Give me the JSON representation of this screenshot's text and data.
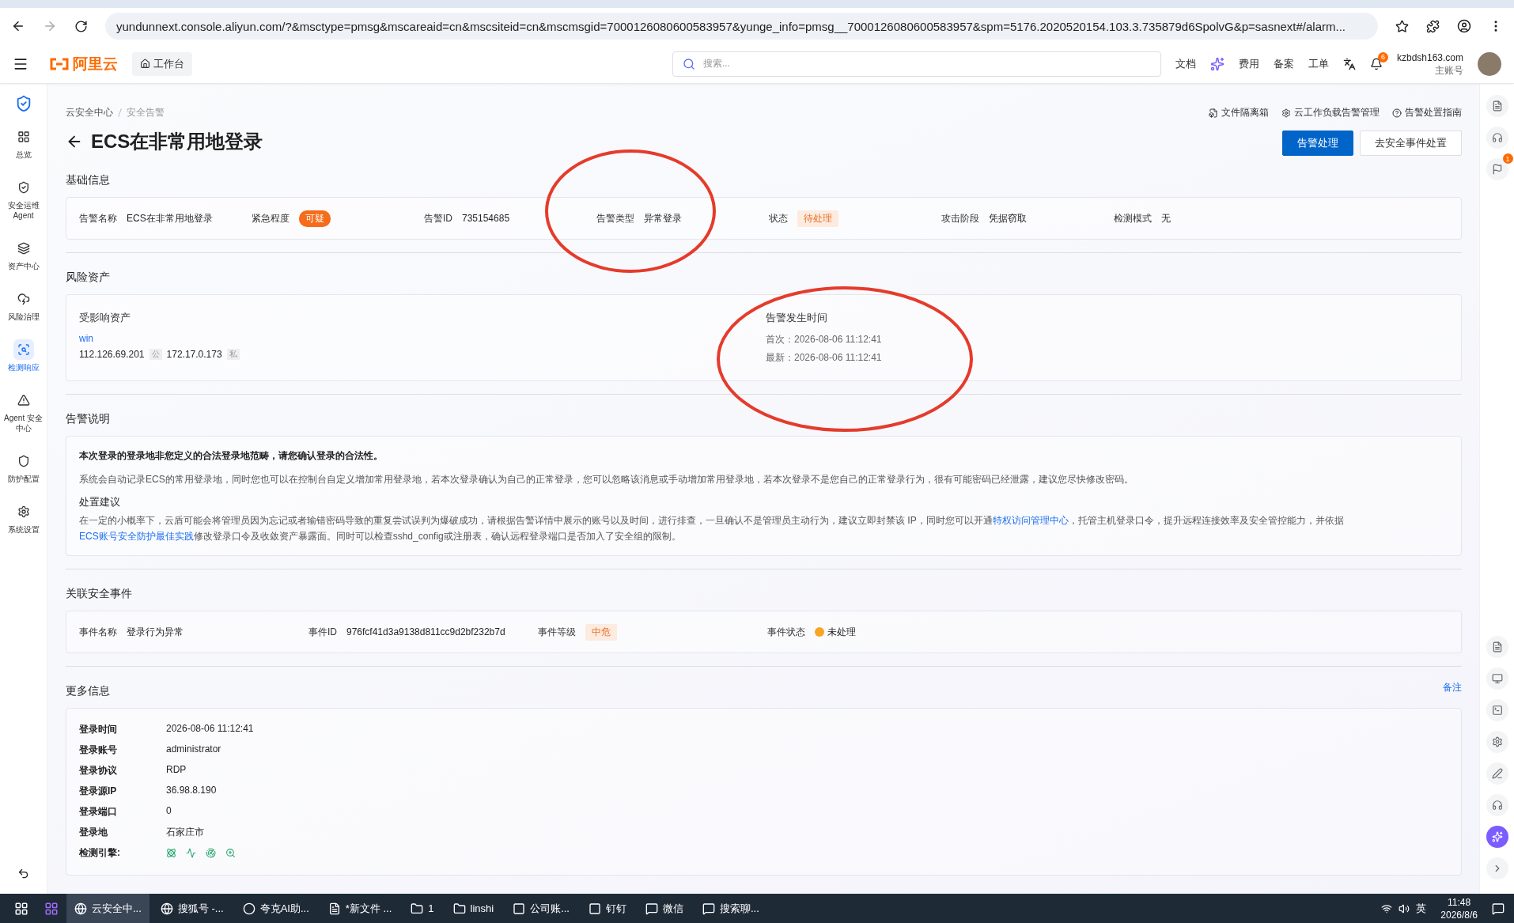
{
  "browser": {
    "url": "yundunnext.console.aliyun.com/?&msctype=pmsg&mscareaid=cn&mscsiteid=cn&mscmsgid=7000126080600583957&yunge_info=pmsg__7000126080600583957&spm=5176.2020520154.103.3.735879d6SpolvG&p=sasnext#/alarm..."
  },
  "header": {
    "logo_text": "阿里云",
    "workbench": "工作台",
    "search_placeholder": "搜索...",
    "nav": [
      "文档",
      "费用",
      "备案",
      "工单"
    ],
    "notification_count": "6",
    "account": "kzbdsh163.com",
    "role": "主账号"
  },
  "sidebar": {
    "items": [
      {
        "label": "总览",
        "selected": false
      },
      {
        "label": "安全运维 Agent",
        "selected": false
      },
      {
        "label": "资产中心",
        "selected": false
      },
      {
        "label": "风险治理",
        "selected": false
      },
      {
        "label": "检测响应",
        "selected": true
      },
      {
        "label": "Agent 安全中心",
        "selected": false
      },
      {
        "label": "防护配置",
        "selected": false
      },
      {
        "label": "系统设置",
        "selected": false
      }
    ]
  },
  "breadcrumb": [
    "云安全中心",
    "安全告警"
  ],
  "title": "ECS在非常用地登录",
  "top_links": [
    "文件隔离箱",
    "云工作负载告警管理",
    "告警处置指南"
  ],
  "buttons": [
    {
      "label": "告警处理",
      "kind": "primary"
    },
    {
      "label": "去安全事件处置",
      "kind": "default"
    }
  ],
  "basic_info": {
    "title": "基础信息",
    "fields": [
      {
        "label": "告警名称",
        "value": "ECS在非常用地登录",
        "kind": "text"
      },
      {
        "label": "紧急程度",
        "value": "可疑",
        "kind": "badge"
      },
      {
        "label": "告警ID",
        "value": "735154685",
        "kind": "text"
      },
      {
        "label": "告警类型",
        "value": "异常登录",
        "kind": "text"
      },
      {
        "label": "状态",
        "value": "待处理",
        "kind": "tag"
      },
      {
        "label": "攻击阶段",
        "value": "凭据窃取",
        "kind": "text"
      },
      {
        "label": "检测模式",
        "value": "无",
        "kind": "text"
      }
    ]
  },
  "risk_assets": {
    "title": "风险资产",
    "affected_title": "受影响资产",
    "asset_name": "win",
    "ips": [
      {
        "ip": "112.126.69.201",
        "tag": "公"
      },
      {
        "ip": "172.17.0.173",
        "tag": "私"
      }
    ],
    "time_title": "告警发生时间",
    "times": [
      "首次：2026-08-06 11:12:41",
      "最新：2026-08-06 11:12:41"
    ]
  },
  "description": {
    "title": "告警说明",
    "headline": "本次登录的登录地非您定义的合法登录地范畴，请您确认登录的合法性。",
    "body": "系统会自动记录ECS的常用登录地，同时您也可以在控制台自定义增加常用登录地，若本次登录确认为自己的正常登录，您可以忽略该消息或手动增加常用登录地，若本次登录不是您自己的正常登录行为，很有可能密码已经泄露，建议您尽快修改密码。",
    "advice_title": "处置建议",
    "advice": [
      {
        "text": "在一定的小概率下，云盾可能会将管理员因为忘记或者输错密码导致的重复尝试误判为爆破成功，请根据告警详情中展示的账号以及时间，进行排查，一旦确认不是管理员主动行为，建议立即封禁该 IP，同时您可以开通",
        "link": false
      },
      {
        "text": "特权访问管理中心",
        "link": true
      },
      {
        "text": "，托管主机登录口令，提升远程连接效率及安全管控能力，并依据",
        "link": false
      },
      {
        "text": "ECS账号安全防护最佳实践",
        "link": true
      },
      {
        "text": "修改登录口令及收敛资产暴露面。同时可以检查sshd_config或注册表，确认远程登录端口是否加入了安全组的限制。",
        "link": false
      }
    ]
  },
  "related_event": {
    "title": "关联安全事件",
    "fields": [
      {
        "label": "事件名称",
        "value": "登录行为异常",
        "kind": "text"
      },
      {
        "label": "事件ID",
        "value": "976fcf41d3a9138d811cc9d2bf232b7d",
        "kind": "text"
      },
      {
        "label": "事件等级",
        "value": "中危",
        "kind": "tag"
      },
      {
        "label": "事件状态",
        "value": "未处理",
        "kind": "status"
      }
    ]
  },
  "more_info": {
    "title": "更多信息",
    "note_link": "备注",
    "rows": [
      {
        "label": "登录时间",
        "value": "2026-08-06 11:12:41"
      },
      {
        "label": "登录账号",
        "value": "administrator"
      },
      {
        "label": "登录协议",
        "value": "RDP"
      },
      {
        "label": "登录源IP",
        "value": "36.98.8.190"
      },
      {
        "label": "登录端口",
        "value": "0"
      },
      {
        "label": "登录地",
        "value": "石家庄市"
      }
    ],
    "engines_label": "检测引擎:"
  },
  "right_rail": {
    "flag_badge": "1"
  },
  "taskbar": {
    "apps": [
      {
        "label": "云安全中...",
        "selected": true
      },
      {
        "label": "搜狐号 -...",
        "selected": false
      },
      {
        "label": "夸克AI助...",
        "selected": false
      },
      {
        "label": "*新文件 ...",
        "selected": false
      },
      {
        "label": "1",
        "selected": false
      },
      {
        "label": "linshi",
        "selected": false
      },
      {
        "label": "公司账...",
        "selected": false
      },
      {
        "label": "钉钉",
        "selected": false
      },
      {
        "label": "微信",
        "selected": false
      },
      {
        "label": "搜索聊...",
        "selected": false
      }
    ],
    "ime": "英",
    "time": "11:48",
    "date": "2026/8/6"
  }
}
